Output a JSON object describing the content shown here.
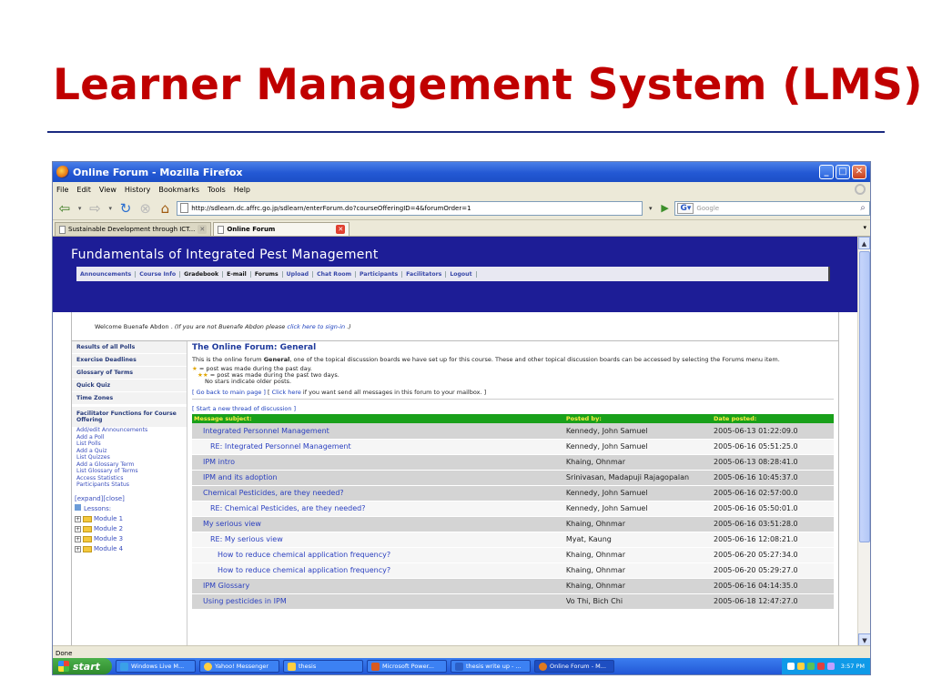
{
  "slide": {
    "title": "Learner Management System (LMS)"
  },
  "browser": {
    "window_title": "Online Forum - Mozilla Firefox",
    "menu": [
      "File",
      "Edit",
      "View",
      "History",
      "Bookmarks",
      "Tools",
      "Help"
    ],
    "url": "http://sdlearn.dc.affrc.go.jp/sdlearn/enterForum.do?courseOfferingID=4&forumOrder=1",
    "search_placeholder": "Google",
    "tabs": [
      {
        "label": "Sustainable Development through ICT..."
      },
      {
        "label": "Online Forum"
      }
    ],
    "status": "Done"
  },
  "page": {
    "course_title": "Fundamentals of Integrated Pest Management",
    "nav": [
      "Announcements",
      "Course Info",
      "Gradebook",
      "E-mail",
      "Forums",
      "Upload",
      "Chat Room",
      "Participants",
      "Facilitators",
      "Logout"
    ],
    "welcome": {
      "prefix": "Welcome Buenafe Abdon .",
      "note_open": "(If you are not Buenafe Abdon please",
      "link": "click here to sign-in",
      "note_close": ".)"
    },
    "sidebar": {
      "blocks": [
        "Results of all Polls",
        "Exercise Deadlines",
        "Glossary of Terms",
        "Quick Quiz",
        "Time Zones"
      ],
      "facilitator_heading": "Facilitator Functions for Course Offering",
      "facilitator_links": [
        "Add/edit Announcements",
        "Add a Poll",
        "List Polls",
        "Add a Quiz",
        "List Quizzes",
        "Add a Glossary Term",
        "List Glossary of Terms",
        "Access Statistics",
        "Participants Status"
      ],
      "tree_controls": "[expand][close]",
      "lessons_label": "Lessons:",
      "modules": [
        "Module 1",
        "Module 2",
        "Module 3",
        "Module 4"
      ]
    },
    "forum": {
      "title": "The Online Forum: General",
      "desc_pre": "This is the online forum ",
      "desc_bold": "General",
      "desc_post": ", one of the topical discussion boards we have set up for this course. These and other topical discussion boards can be accessed by selecting the Forums menu item.",
      "legend_1": "= post was made during the past day.",
      "legend_2": "= post was made during the past two days.",
      "legend_3": "No stars indicate older posts.",
      "back_link": "[ Go back to main page ]",
      "click_here_open": "[",
      "click_here": "Click here",
      "click_here_rest": "if you want send all messages in this forum to your mailbox. ]",
      "start_thread": "[ Start a new thread of discussion ]",
      "columns": [
        "Message subject:",
        "Posted by:",
        "Date posted:"
      ],
      "rows": [
        {
          "subject": "Integrated Personnel Management",
          "by": "Kennedy, John Samuel",
          "date": "2005-06-13 01:22:09.0",
          "indent": 0
        },
        {
          "subject": "RE: Integrated Personnel Management",
          "by": "Kennedy, John Samuel",
          "date": "2005-06-16 05:51:25.0",
          "indent": 1
        },
        {
          "subject": "IPM intro",
          "by": "Khaing, Ohnmar",
          "date": "2005-06-13 08:28:41.0",
          "indent": 0
        },
        {
          "subject": "IPM and its adoption",
          "by": "Srinivasan, Madapuji Rajagopalan",
          "date": "2005-06-16 10:45:37.0",
          "indent": 0
        },
        {
          "subject": "Chemical Pesticides, are they needed?",
          "by": "Kennedy, John Samuel",
          "date": "2005-06-16 02:57:00.0",
          "indent": 0
        },
        {
          "subject": "RE: Chemical Pesticides, are they needed?",
          "by": "Kennedy, John Samuel",
          "date": "2005-06-16 05:50:01.0",
          "indent": 1
        },
        {
          "subject": "My serious view",
          "by": "Khaing, Ohnmar",
          "date": "2005-06-16 03:51:28.0",
          "indent": 0
        },
        {
          "subject": "RE: My serious view",
          "by": "Myat, Kaung",
          "date": "2005-06-16 12:08:21.0",
          "indent": 1
        },
        {
          "subject": "How to reduce chemical application frequency?",
          "by": "Khaing, Ohnmar",
          "date": "2005-06-20 05:27:34.0",
          "indent": 2
        },
        {
          "subject": "How to reduce chemical application frequency?",
          "by": "Khaing, Ohnmar",
          "date": "2005-06-20 05:29:27.0",
          "indent": 2
        },
        {
          "subject": "IPM Glossary",
          "by": "Khaing, Ohnmar",
          "date": "2005-06-16 04:14:35.0",
          "indent": 0
        },
        {
          "subject": "Using pesticides in IPM",
          "by": "Vo Thi, Bich Chi",
          "date": "2005-06-18 12:47:27.0",
          "indent": 0
        }
      ]
    }
  },
  "taskbar": {
    "start_label": "start",
    "tasks": [
      "Windows Live M...",
      "Yahoo! Messenger",
      "thesis",
      "Microsoft Power...",
      "thesis write up - ...",
      "Online Forum - M..."
    ],
    "clock": "3:57 PM"
  },
  "colors": {
    "title_red": "#c00000",
    "header_blue": "#1d1d96",
    "table_header_green": "#19a01a"
  }
}
